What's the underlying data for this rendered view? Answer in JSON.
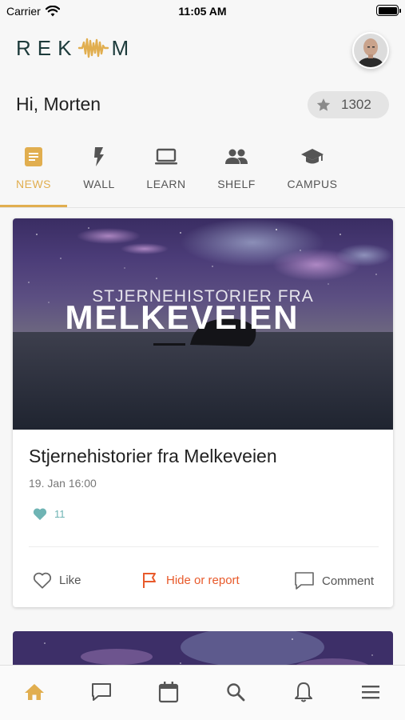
{
  "status_bar": {
    "carrier": "Carrier",
    "time": "11:05 AM"
  },
  "header": {
    "logo_text_left": "REK",
    "logo_text_right": "M"
  },
  "greeting": {
    "prefix": "Hi,",
    "name": "Morten"
  },
  "points": {
    "value": "1302",
    "icon": "star-icon"
  },
  "tabs": [
    {
      "label": "NEWS",
      "icon": "news-icon",
      "active": true
    },
    {
      "label": "WALL",
      "icon": "bolt-icon",
      "active": false
    },
    {
      "label": "LEARN",
      "icon": "laptop-icon",
      "active": false
    },
    {
      "label": "SHELF",
      "icon": "people-icon",
      "active": false
    },
    {
      "label": "CAMPUS",
      "icon": "graduation-cap-icon",
      "active": false
    }
  ],
  "feed": [
    {
      "image_title_line1": "STJERNEHISTORIER FRA",
      "image_title_line2": "MELKEVEIEN",
      "title": "Stjernehistorier fra Melkeveien",
      "date": "19. Jan 16:00",
      "likes": "11",
      "actions": {
        "like": "Like",
        "report": "Hide or report",
        "comment": "Comment"
      }
    }
  ],
  "bottom_nav": [
    {
      "icon": "home-icon",
      "active": true
    },
    {
      "icon": "chat-icon",
      "active": false
    },
    {
      "icon": "calendar-icon",
      "active": false
    },
    {
      "icon": "search-icon",
      "active": false
    },
    {
      "icon": "bell-icon",
      "active": false
    },
    {
      "icon": "menu-icon",
      "active": false
    }
  ],
  "colors": {
    "accent": "#e1ae4f",
    "report": "#e85a2b",
    "like": "#6fb4b4",
    "logo": "#1d3b3b"
  }
}
